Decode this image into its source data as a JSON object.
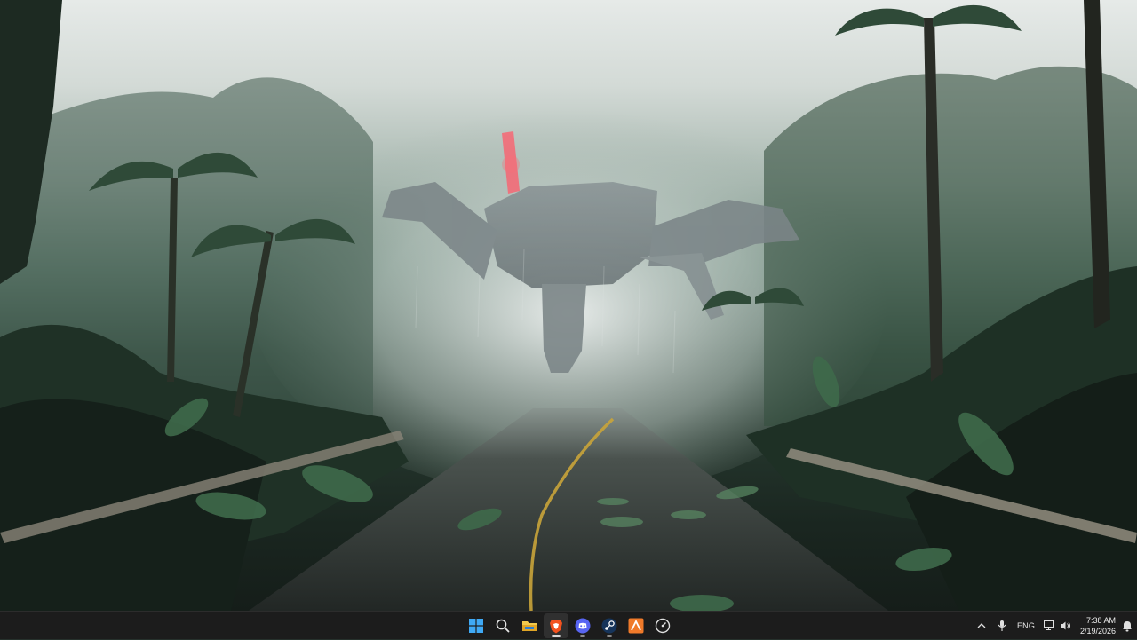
{
  "desktop": {
    "wallpaper": "jungle-road-mech-wallpaper",
    "palette": {
      "fog": "#dfe4e2",
      "jungle_dark": "#1a2620",
      "road": "#2b302e",
      "line_yellow": "#c9a43a",
      "mech_glow": "#ff4a5a"
    }
  },
  "taskbar": {
    "background": "#1c1c1c",
    "apps": [
      {
        "name": "Start",
        "icon": "windows-start-icon",
        "active": false
      },
      {
        "name": "Search",
        "icon": "search-icon",
        "active": false
      },
      {
        "name": "File Explorer",
        "icon": "folder-icon",
        "active": false
      },
      {
        "name": "Brave",
        "icon": "brave-browser-icon",
        "active": true
      },
      {
        "name": "Discord",
        "icon": "discord-icon",
        "active": false
      },
      {
        "name": "Steam",
        "icon": "steam-icon",
        "active": false
      },
      {
        "name": "App",
        "icon": "orange-app-icon",
        "active": false
      },
      {
        "name": "App",
        "icon": "gauge-app-icon",
        "active": false
      }
    ],
    "tray": {
      "language": "ENG",
      "time": "7:38 AM",
      "date": "2/19/2026"
    }
  }
}
